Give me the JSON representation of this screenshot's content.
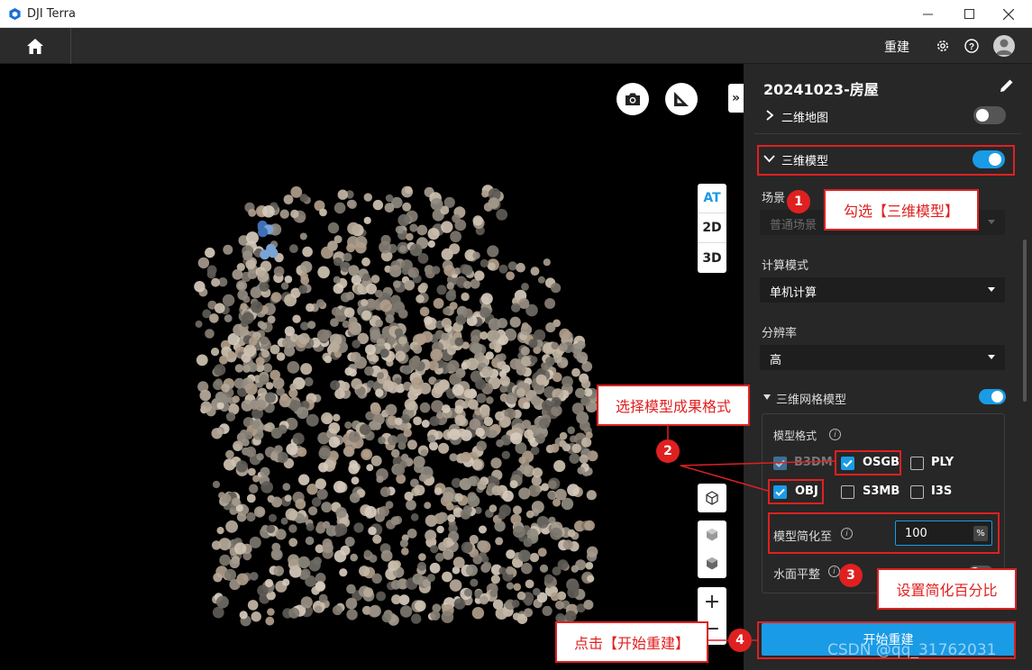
{
  "window": {
    "title": "DJI Terra",
    "minimize_label": "—",
    "maximize_label": "☐",
    "close_label": "✕"
  },
  "navbar": {
    "reconstruct_label": "重建"
  },
  "viewport": {
    "collapse_label": "»",
    "view_modes": [
      "AT",
      "2D",
      "3D"
    ],
    "active_view_mode": "AT",
    "zoom_in_label": "+",
    "zoom_out_label": "−"
  },
  "panel": {
    "title": "20241023-房屋",
    "map2d_label": "二维地图",
    "map2d_enabled": false,
    "model3d_label": "三维模型",
    "model3d_enabled": true,
    "scene_label": "场景",
    "scene_value": "普通场景",
    "compute_mode_label": "计算模式",
    "compute_mode_value": "单机计算",
    "resolution_label": "分辨率",
    "resolution_value": "高",
    "mesh_label": "三维网格模型",
    "mesh_enabled": true,
    "format_label": "模型格式",
    "formats": [
      {
        "name": "B3DM",
        "checked": true,
        "disabled": true
      },
      {
        "name": "OSGB",
        "checked": true,
        "disabled": false
      },
      {
        "name": "PLY",
        "checked": false,
        "disabled": false
      },
      {
        "name": "OBJ",
        "checked": true,
        "disabled": false
      },
      {
        "name": "S3MB",
        "checked": false,
        "disabled": false
      },
      {
        "name": "I3S",
        "checked": false,
        "disabled": false
      }
    ],
    "simplify_label": "模型简化至",
    "simplify_value": "100",
    "simplify_unit": "%",
    "water_label": "水面平整",
    "water_enabled": false,
    "start_button": "开始重建"
  },
  "annotations": [
    {
      "num": "1",
      "text": "勾选【三维模型】"
    },
    {
      "num": "2",
      "text": "选择模型成果格式"
    },
    {
      "num": "3",
      "text": "设置简化百分比"
    },
    {
      "num": "4",
      "text": "点击【开始重建】"
    }
  ],
  "watermark": "CSDN @qq_31762031",
  "colors": {
    "accent": "#1a9be6",
    "annotation": "#e02020",
    "panel_bg": "#272727",
    "navbar_bg": "#2b2b2b"
  }
}
